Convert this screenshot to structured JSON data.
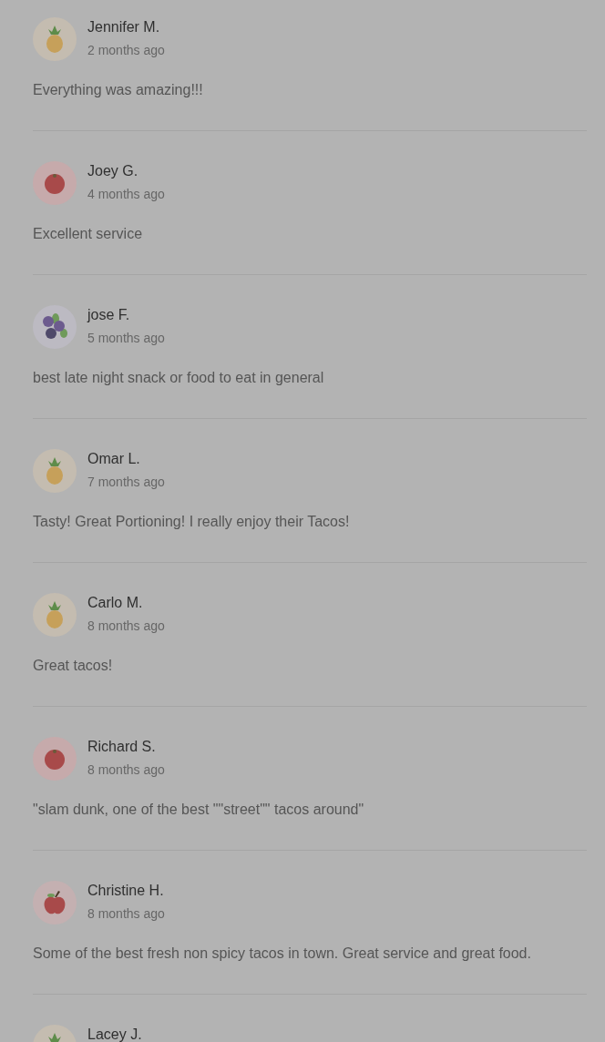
{
  "reviews": [
    {
      "name": "Jennifer M.",
      "time": "2 months ago",
      "comment": "Everything was amazing!!!",
      "kind": "pineapple"
    },
    {
      "name": "Joey G.",
      "time": "4 months ago",
      "comment": "Excellent service",
      "kind": "tomato"
    },
    {
      "name": "jose F.",
      "time": "5 months ago",
      "comment": "best late night snack or food to eat in general",
      "kind": "blueberry"
    },
    {
      "name": "Omar L.",
      "time": "7 months ago",
      "comment": "Tasty! Great Portioning! I really enjoy their Tacos!",
      "kind": "pineapple"
    },
    {
      "name": "Carlo M.",
      "time": "8 months ago",
      "comment": "Great tacos!",
      "kind": "pineapple"
    },
    {
      "name": "Richard S.",
      "time": "8 months ago",
      "comment": "\"slam dunk, one of the best \"\"street\"\" tacos around\"",
      "kind": "tomato"
    },
    {
      "name": "Christine H.",
      "time": "8 months ago",
      "comment": "Some of the best fresh non spicy tacos in town. Great service and great food.",
      "kind": "apple"
    },
    {
      "name": "Lacey J.",
      "kind": "pineapple"
    }
  ]
}
